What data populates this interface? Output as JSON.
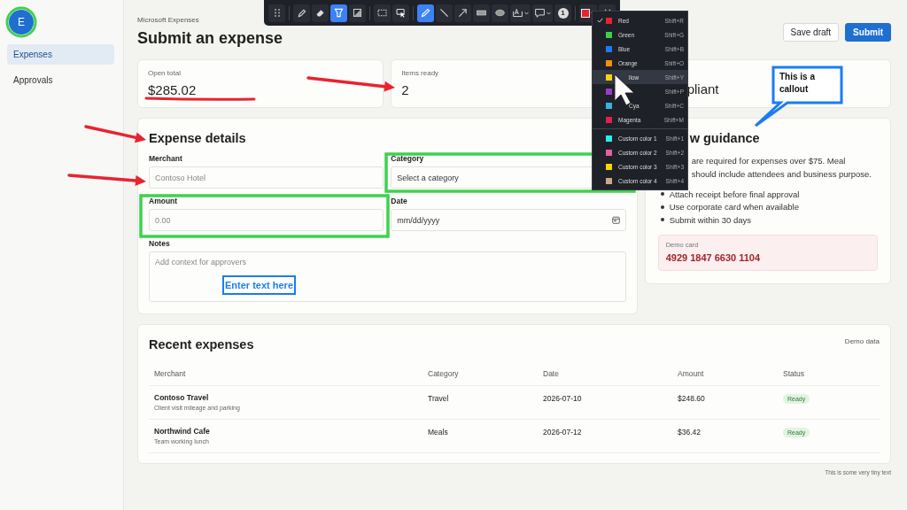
{
  "toolbar": {
    "groups": [
      {
        "tools": [
          {
            "kind": "pen",
            "selected": false
          },
          {
            "kind": "eraser",
            "selected": false
          },
          {
            "kind": "highlighter",
            "selected": true
          },
          {
            "kind": "fill",
            "selected": false
          }
        ]
      },
      {
        "tools": [
          {
            "kind": "select",
            "selected": false
          },
          {
            "kind": "pointer",
            "selected": false
          }
        ]
      },
      {
        "tools": [
          {
            "kind": "pencil",
            "selected": true
          },
          {
            "kind": "line",
            "selected": false
          },
          {
            "kind": "arrow",
            "selected": false
          },
          {
            "kind": "rect",
            "selected": false
          },
          {
            "kind": "ellipse",
            "selected": false
          },
          {
            "kind": "text",
            "selected": false
          },
          {
            "kind": "callout",
            "selected": false
          },
          {
            "kind": "step",
            "label": "1",
            "selected": false
          }
        ]
      }
    ],
    "color_button": {
      "color": "#e8232f"
    }
  },
  "color_menu": {
    "colors": [
      {
        "label": "Red",
        "color": "#e8232f",
        "shortcut": "Shift+R",
        "checked": true,
        "hovered": false,
        "obscured": false
      },
      {
        "label": "Green",
        "color": "#3ccf4e",
        "shortcut": "Shift+G",
        "checked": false,
        "hovered": false,
        "obscured": false
      },
      {
        "label": "Blue",
        "color": "#1a7cf5",
        "shortcut": "Shift+B",
        "checked": false,
        "hovered": false,
        "obscured": false
      },
      {
        "label": "Orange",
        "color": "#f0900c",
        "shortcut": "Shift+O",
        "checked": false,
        "hovered": false,
        "obscured": false
      },
      {
        "label": "llow",
        "color": "#f5d414",
        "shortcut": "Shift+Y",
        "checked": false,
        "hovered": true,
        "obscured": true
      },
      {
        "color": "#9b3ad0",
        "shortcut": "Shift+P",
        "checked": false,
        "hovered": false
      },
      {
        "label": "Cya",
        "color": "#33b5e0",
        "shortcut": "Shift+C",
        "checked": false,
        "hovered": false,
        "obscured": true
      },
      {
        "label": "Magenta",
        "color": "#e0224a",
        "shortcut": "Shift+M",
        "checked": false,
        "hovered": false,
        "obscured": false
      }
    ],
    "custom_colors": [
      {
        "label": "Custom color 1",
        "color": "#22f0f0",
        "shortcut": "Shift+1",
        "checked": false
      },
      {
        "label": "Custom color 2",
        "color": "#e55fa3",
        "shortcut": "Shift+2",
        "checked": false
      },
      {
        "label": "Custom color 3",
        "color": "#f5d800",
        "shortcut": "Shift+3",
        "checked": false
      },
      {
        "label": "Custom color 4",
        "color": "#c9a98a",
        "shortcut": "Shift+4",
        "checked": false
      }
    ]
  },
  "sidebar": {
    "avatar": "E",
    "items": [
      {
        "label": "Expenses",
        "selected": true
      },
      {
        "label": "Approvals",
        "selected": false
      }
    ]
  },
  "header": {
    "app_name": "Microsoft Expenses",
    "title": "Submit an expense",
    "buttons": [
      {
        "label": "Save draft",
        "kind": "secondary"
      },
      {
        "label": "Submit",
        "kind": "primary"
      }
    ]
  },
  "stats": [
    {
      "label": "Open total",
      "value": "$285.02"
    },
    {
      "label": "Items ready",
      "value": "2"
    },
    {
      "value": "pliant"
    }
  ],
  "expense_form": {
    "title": "Expense details",
    "fields": [
      {
        "label": "Merchant",
        "kind": "text",
        "placeholder": "Contoso Hotel"
      },
      {
        "label": "Category",
        "kind": "select",
        "value": "Select a category"
      },
      {
        "label": "Amount",
        "kind": "text",
        "placeholder": "0.00"
      },
      {
        "label": "Date",
        "kind": "date",
        "placeholder": "mm/dd/yyyy"
      },
      {
        "label": "Notes",
        "kind": "textarea",
        "placeholder": "Add context for approvers"
      }
    ]
  },
  "guidance": {
    "title": "w guidance",
    "text_lines": [
      "are required for expenses over $75. Meal",
      "should include attendees and business purpose."
    ],
    "bullets": [
      "Attach receipt before final approval",
      "Use corporate card when available",
      "Submit within 30 days"
    ],
    "demo_card": {
      "label": "Demo card",
      "number": "4929 1847 6630 1104"
    }
  },
  "recent": {
    "title": "Recent expenses",
    "note": "Demo data",
    "columns": [
      "Merchant",
      "Category",
      "Date",
      "Amount",
      "Status"
    ],
    "rows": [
      {
        "merchant": "Contoso Travel",
        "description": "Client visit mileage and parking",
        "category": "Travel",
        "date": "2026-07-10",
        "amount": "$248.60",
        "status": "Ready"
      },
      {
        "merchant": "Northwind Cafe",
        "description": "Team working lunch",
        "category": "Meals",
        "date": "2026-07-12",
        "amount": "$36.42",
        "status": "Ready"
      }
    ]
  },
  "footer_note": "This is some very tiny text",
  "annotations": [
    {
      "kind": "ellipse",
      "color": "#3fd14f"
    },
    {
      "kind": "underline",
      "color": "#e8232f"
    },
    {
      "kind": "arrow",
      "color": "#e8232f"
    },
    {
      "kind": "arrow",
      "color": "#e8232f"
    },
    {
      "kind": "arrow",
      "color": "#e8232f"
    },
    {
      "kind": "rectangle",
      "color": "#3fd14f"
    },
    {
      "kind": "rectangle",
      "color": "#3fd14f"
    },
    {
      "kind": "textbox",
      "color": "#1a7cf5",
      "text": "Enter text here"
    },
    {
      "kind": "callout",
      "color": "#1a7cf5",
      "text": "This is a callout"
    },
    {
      "kind": "cursor"
    }
  ]
}
